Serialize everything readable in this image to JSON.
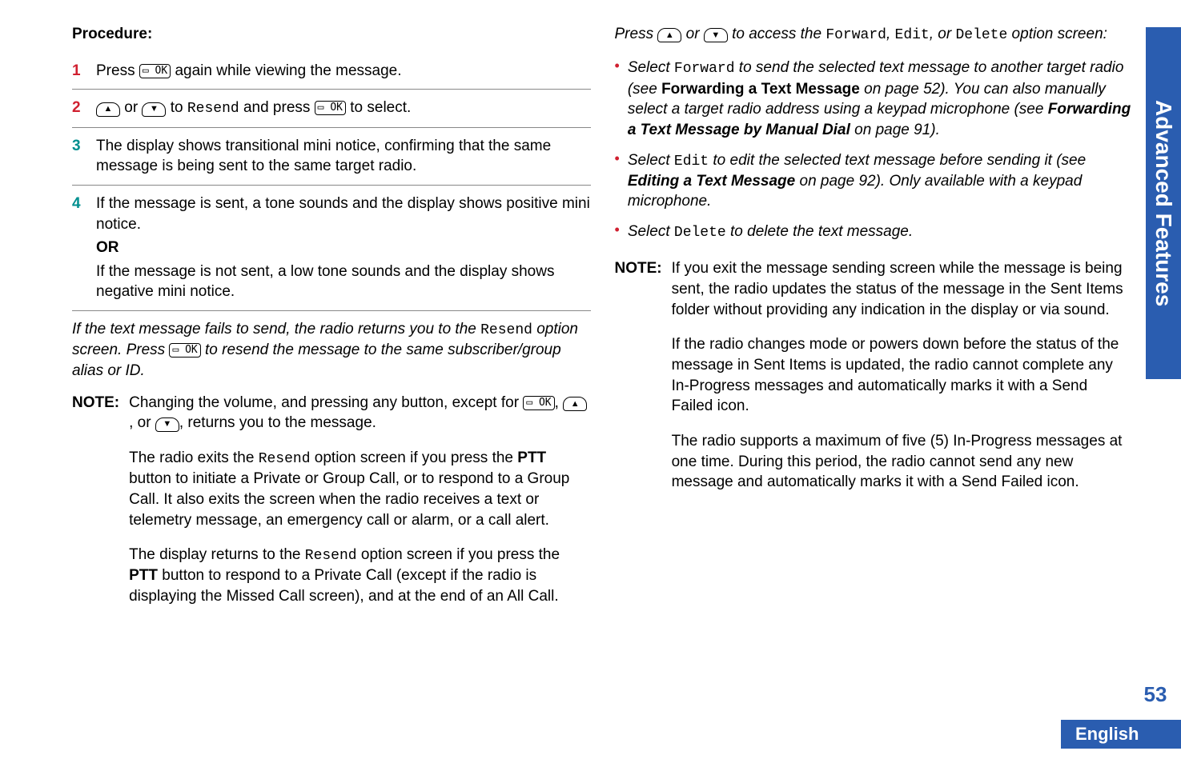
{
  "sideTab": "Advanced Features",
  "pageNumber": "53",
  "language": "English",
  "left": {
    "procedureHeading": "Procedure:",
    "iconOk": "▭ OK",
    "steps": [
      {
        "num": "1",
        "pre": "Press ",
        "post": " again while viewing the message."
      },
      {
        "num": "2",
        "a": " or ",
        "b": " to ",
        "resend": "Resend",
        "c": " and press ",
        "d": " to select."
      },
      {
        "num": "3",
        "text": "The display shows transitional mini notice, confirming that the same message is being sent to the same target radio."
      },
      {
        "num": "4",
        "line1": "If the message is sent, a tone sounds and the display shows positive mini notice.",
        "or": "OR",
        "line2": "If the message is not sent, a low tone sounds and the display shows negative mini notice."
      }
    ],
    "para1a": "If the text message fails to send, the radio returns you to the ",
    "para1resend": "Resend",
    "para1b": " option screen. Press ",
    "para1c": " to resend the message to the same subscriber/group alias or ID.",
    "noteLabel": "NOTE:",
    "noteP1a": "Changing the volume, and pressing any button, except for ",
    "noteP1b": ", ",
    "noteP1c": ", or ",
    "noteP1d": ", returns you to the message.",
    "noteP2a": "The radio exits the ",
    "noteP2resend": "Resend",
    "noteP2b": " option screen if you press the ",
    "noteP2ptt": "PTT",
    "noteP2c": " button to initiate a Private or Group Call, or to respond to a Group Call. It also exits the screen when the radio receives a text or telemetry message, an emergency call or alarm, or a call alert.",
    "noteP3a": "The display returns to the ",
    "noteP3resend": "Resend",
    "noteP3b": " option screen if you press the ",
    "noteP3ptt": "PTT",
    "noteP3c": " button to respond to a Private Call (except if the radio is displaying the Missed Call screen), and at the end of an All Call."
  },
  "right": {
    "introA": "Press ",
    "introB": " or ",
    "introC": " to access the ",
    "forward": "Forward",
    "comma1": ", ",
    "edit": "Edit",
    "commaOr": ", or ",
    "delete": "Delete",
    "introD": " option screen:",
    "bullets": [
      {
        "a": "Select ",
        "kw": "Forward",
        "b": " to send the selected text message to another target radio (see ",
        "bold1": "Forwarding a Text Message",
        "c": " on page 52). You can also manually select a target radio address using a keypad microphone (see ",
        "boldItal": "Forwarding a Text Message by Manual Dial",
        "d": " on page 91)."
      },
      {
        "a": "Select ",
        "kw": "Edit",
        "b": " to edit the selected text message before sending it (see ",
        "boldItal": "Editing a Text Message",
        "c": " on page 92). Only available with a keypad microphone."
      },
      {
        "a": "Select ",
        "kw": "Delete",
        "b": " to delete the text message."
      }
    ],
    "noteLabel": "NOTE:",
    "noteP1": "If you exit the message sending screen while the message is being sent, the radio updates the status of the message in the Sent Items folder without providing any indication in the display or via sound.",
    "noteP2": "If the radio changes mode or powers down before the status of the message in Sent Items is updated, the radio cannot complete any In-Progress messages and automatically marks it with a Send Failed icon.",
    "noteP3": "The radio supports a maximum of five (5) In-Progress messages at one time. During this period, the radio cannot send any new message and automatically marks it with a Send Failed icon."
  }
}
